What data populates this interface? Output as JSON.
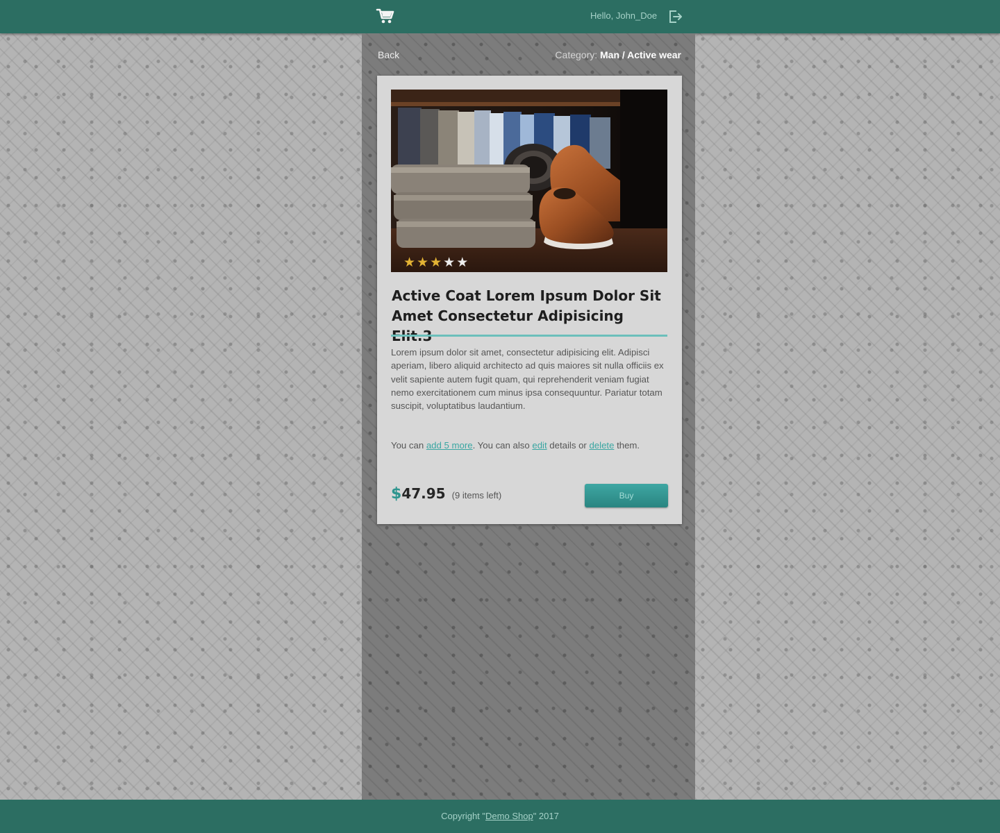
{
  "header": {
    "cart_icon": "shopping-cart-icon",
    "greeting": "Hello, John_Doe",
    "logout_icon": "sign-out-icon"
  },
  "nav": {
    "back_label": "Back",
    "category_label": "Category:",
    "category_value": "Man / Active wear"
  },
  "product": {
    "image_alt": "clothing-rack-coat-shoes-photo",
    "rating": 3,
    "rating_max": 5,
    "title": "Active Coat Lorem Ipsum Dolor Sit Amet Consectetur Adipisicing Elit.3",
    "description": "Lorem ipsum dolor sit amet, consectetur adipisicing elit. Adipisci aperiam, libero aliquid architecto ad quis maiores sit nulla officiis ex velit sapiente autem fugit quam, qui reprehenderit veniam fugiat nemo exercitationem cum minus ipsa consequuntur. Pariatur totam suscipit, voluptatibus laudantium.",
    "actions": {
      "prefix": "You can ",
      "add_more_link": "add 5 more",
      "middle": ". You can also ",
      "edit_link": "edit",
      "between": " details or ",
      "delete_link": "delete",
      "suffix": " them."
    },
    "price_currency": "$",
    "price_amount": "47.95",
    "stock_note": "(9 items left)",
    "buy_label": "Buy"
  },
  "footer": {
    "prefix": "Copyright \"",
    "link": "Demo Shop",
    "suffix": "\" 2017"
  },
  "colors": {
    "header_bg": "#2c6e62",
    "accent": "#3aa6a2",
    "star_filled": "#e3b334",
    "card_bg": "#d7d7d7"
  }
}
